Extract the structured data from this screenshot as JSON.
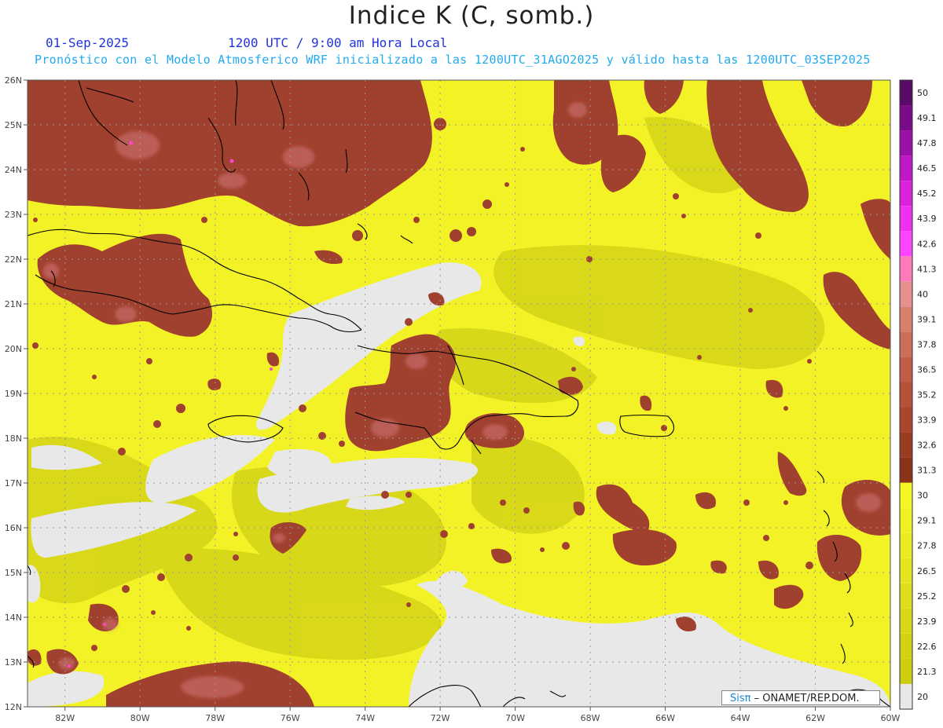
{
  "header": {
    "title": "Indice K (C, somb.)",
    "date": "01-Sep-2025",
    "time": "1200 UTC / 9:00 am Hora Local",
    "forecast": "Pronóstico con el Modelo Atmosferico WRF inicializado a las 1200UTC_31AGO2025 y válido hasta las  1200UTC_03SEP2025"
  },
  "map": {
    "lon_range": [
      -83,
      -60
    ],
    "lat_range": [
      12,
      26
    ],
    "lon_ticks": [
      "82W",
      "80W",
      "78W",
      "76W",
      "74W",
      "72W",
      "70W",
      "68W",
      "66W",
      "64W",
      "62W",
      "60W"
    ],
    "lat_ticks": [
      "12N",
      "13N",
      "14N",
      "15N",
      "16N",
      "17N",
      "18N",
      "19N",
      "20N",
      "21N",
      "22N",
      "23N",
      "24N",
      "25N",
      "26N"
    ],
    "colors": {
      "below20": "#e8e8e8",
      "yellow": "#f2f226",
      "olive": "#d0d016",
      "brown": "#a0402e",
      "pink": "#d2787a"
    }
  },
  "colorbar": {
    "labels": [
      "20",
      "21.3",
      "22.6",
      "23.9",
      "25.2",
      "26.5",
      "27.8",
      "29.1",
      "30",
      "31.3",
      "32.6",
      "33.9",
      "35.2",
      "36.5",
      "37.8",
      "39.1",
      "40",
      "41.3",
      "42.6",
      "43.9",
      "45.2",
      "46.5",
      "47.8",
      "49.1",
      "50"
    ],
    "colors": [
      "#e8e8e8",
      "#cccc10",
      "#d2d214",
      "#d8d818",
      "#dede1c",
      "#e4e420",
      "#eaea22",
      "#f0f024",
      "#f6f626",
      "#8b3318",
      "#9a3c22",
      "#a8472e",
      "#b4523a",
      "#c05e48",
      "#cc6e5a",
      "#d8806e",
      "#e69090",
      "#ff7ab8",
      "#ff44ff",
      "#f030f0",
      "#dd22dd",
      "#c018c8",
      "#9a10a8",
      "#7a0c88",
      "#5a0a68"
    ]
  },
  "credit": {
    "brand": "Sisπ",
    "text": " – ONAMET/REP.DOM."
  }
}
